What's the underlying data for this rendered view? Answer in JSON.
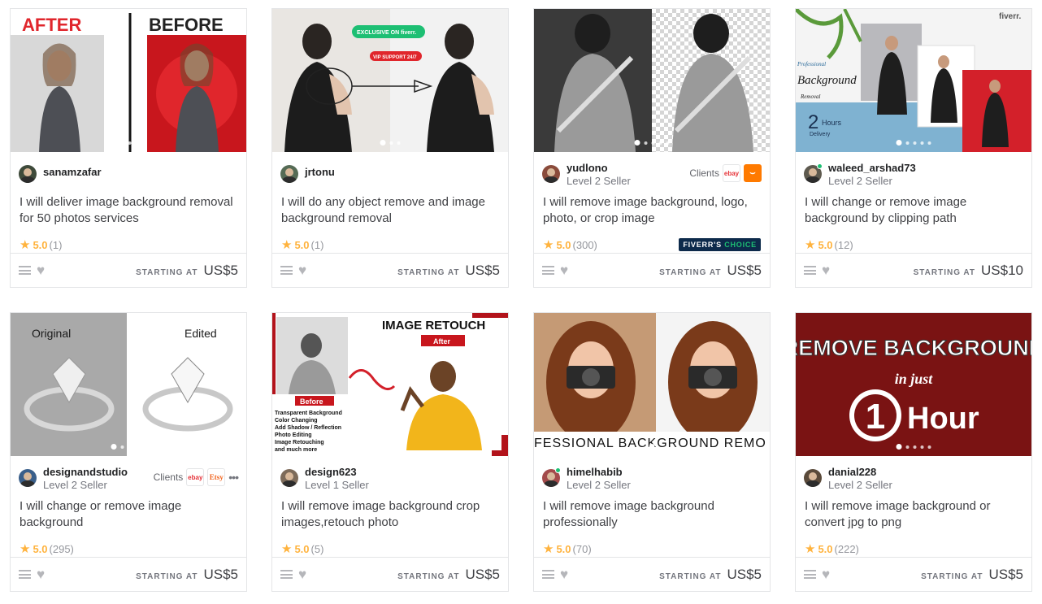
{
  "gigs": [
    {
      "seller": "sanamzafar",
      "level": "",
      "online": false,
      "title": "I will deliver image background removal for 50 photos services",
      "rating": "5.0",
      "reviews": "(1)",
      "starting_label": "STARTING AT",
      "price": "US$5",
      "thumb": {
        "left_label": "AFTER",
        "right_label": "BEFORE"
      }
    },
    {
      "seller": "jrtonu",
      "level": "",
      "online": false,
      "title": "I will do any object remove and image background removal",
      "rating": "5.0",
      "reviews": "(1)",
      "starting_label": "STARTING AT",
      "price": "US$5",
      "thumb": {
        "badge": "EXCLUSIVE ON fiverr.",
        "sub_badge": "VIP SUPPORT 24/7"
      }
    },
    {
      "seller": "yudlono",
      "level": "Level 2 Seller",
      "online": false,
      "clients_label": "Clients",
      "client_logos": [
        "ebay",
        "amazon"
      ],
      "title": "I will remove image background, logo, photo, or crop image",
      "rating": "5.0",
      "reviews": "(300)",
      "choice_badge": {
        "part1": "FIVERR'S",
        "part2": "CHOICE"
      },
      "starting_label": "STARTING AT",
      "price": "US$5"
    },
    {
      "seller": "waleed_arshad73",
      "level": "Level 2 Seller",
      "online": true,
      "title": "I will change or remove image background by clipping path",
      "rating": "5.0",
      "reviews": "(12)",
      "starting_label": "STARTING AT",
      "price": "US$10",
      "thumb": {
        "brand": "fiverr.",
        "l1": "Professional",
        "l2": "Background",
        "l3": "Removal",
        "num": "2",
        "unit": "Hours",
        "sub": "Delivery"
      }
    },
    {
      "seller": "designandstudio",
      "level": "Level 2 Seller",
      "online": false,
      "clients_label": "Clients",
      "client_logos": [
        "ebay",
        "Etsy"
      ],
      "title": "I will change or remove image background",
      "rating": "5.0",
      "reviews": "(295)",
      "starting_label": "STARTING AT",
      "price": "US$5",
      "thumb": {
        "left_label": "Original",
        "right_label": "Edited"
      }
    },
    {
      "seller": "design623",
      "level": "Level 1 Seller",
      "online": false,
      "title": "I will remove image background crop images,retouch photo",
      "rating": "5.0",
      "reviews": "(5)",
      "starting_label": "STARTING AT",
      "price": "US$5",
      "thumb": {
        "heading": "IMAGE RETOUCH",
        "after": "After",
        "before": "Before",
        "list": [
          "Transparent Background",
          "Color Changing",
          "Add Shadow / Reflection",
          "Photo Editing",
          "Image Retouching",
          "and much more"
        ]
      }
    },
    {
      "seller": "himelhabib",
      "level": "Level 2 Seller",
      "online": true,
      "title": "I will remove image background professionally",
      "rating": "5.0",
      "reviews": "(70)",
      "starting_label": "STARTING AT",
      "price": "US$5",
      "thumb": {
        "strip": "FESSIONAL BACKGROUND REMO"
      }
    },
    {
      "seller": "danial228",
      "level": "Level 2 Seller",
      "online": false,
      "title": "I will remove image background or convert jpg to png",
      "rating": "5.0",
      "reviews": "(222)",
      "starting_label": "STARTING AT",
      "price": "US$5",
      "thumb": {
        "l1": "REMOVE BACKGROUND",
        "l2": "in just",
        "num": "1",
        "unit": "Hour"
      }
    }
  ],
  "colors": {
    "star": "#ffb33e",
    "border": "#e4e5e7",
    "online": "#1dbf73",
    "choice_bg": "#0d2a4b"
  },
  "icons": {
    "menu": "list-icon",
    "favorite": "heart-icon",
    "rating": "star-icon"
  }
}
